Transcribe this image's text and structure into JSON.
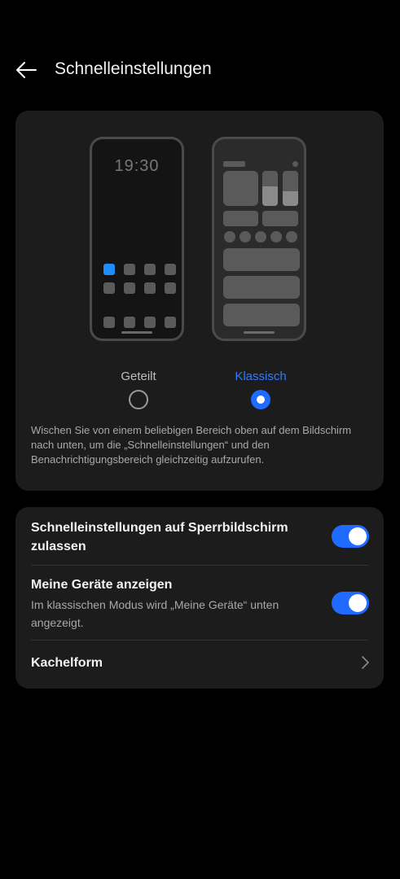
{
  "header": {
    "back_icon": "arrow-left-icon",
    "title": "Schnelleinstellungen"
  },
  "preview": {
    "left_phone_time": "19:30",
    "options": [
      {
        "label": "Geteilt",
        "selected": false
      },
      {
        "label": "Klassisch",
        "selected": true
      }
    ],
    "description": "Wischen Sie von einem beliebigen Bereich oben auf dem Bildschirm nach unten, um die „Schnelleinstellungen“ und den Benachrichtigungsbereich gleichzeitig aufzurufen."
  },
  "settings": {
    "lockscreen": {
      "title": "Schnelleinstellungen auf Sperrbildschirm zulassen",
      "enabled": true
    },
    "devices": {
      "title": "Meine Geräte anzeigen",
      "subtitle": "Im klassischen Modus wird „Meine Geräte“ unten angezeigt.",
      "enabled": true
    },
    "tile_shape": {
      "title": "Kachelform",
      "icon": "chevron-right-icon"
    }
  },
  "colors": {
    "accent": "#1f6bff",
    "highlight_tile": "#1f8cff",
    "selected_label": "#2f7bff",
    "unselected_label": "#bdbdbd"
  }
}
